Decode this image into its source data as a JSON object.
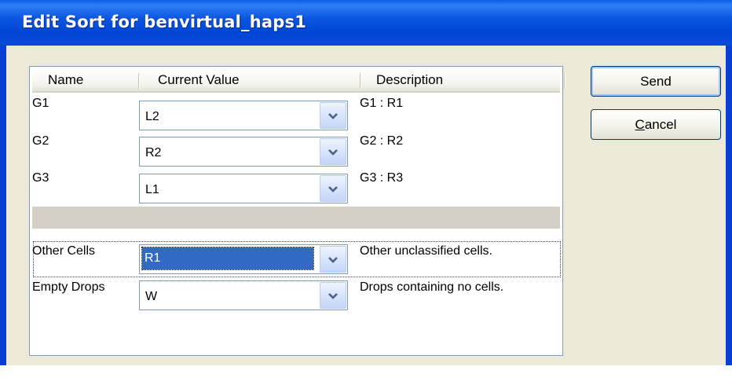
{
  "window": {
    "title": "Edit Sort for benvirtual_haps1"
  },
  "list": {
    "columns": [
      "Name",
      "Current Value",
      "Description"
    ],
    "rows": [
      {
        "name": "G1",
        "value": "L2",
        "description": "G1 : R1"
      },
      {
        "name": "G2",
        "value": "R2",
        "description": "G2 : R2"
      },
      {
        "name": "G3",
        "value": "L1",
        "description": "G3 : R3"
      }
    ],
    "special_rows": [
      {
        "name": "Other Cells",
        "value": "R1",
        "description": "Other unclassified cells."
      },
      {
        "name": "Empty Drops",
        "value": "W",
        "description": "Drops containing no cells."
      }
    ]
  },
  "buttons": {
    "send_label": "Send",
    "cancel_mnemonic": "C",
    "cancel_rest": "ancel"
  },
  "icons": {
    "combo_arrow": "chevron-down-icon"
  },
  "colors": {
    "titlebar": "#0054e3",
    "client_bg": "#ece9d8",
    "selection": "#316ac5",
    "border": "#7f9db9"
  }
}
